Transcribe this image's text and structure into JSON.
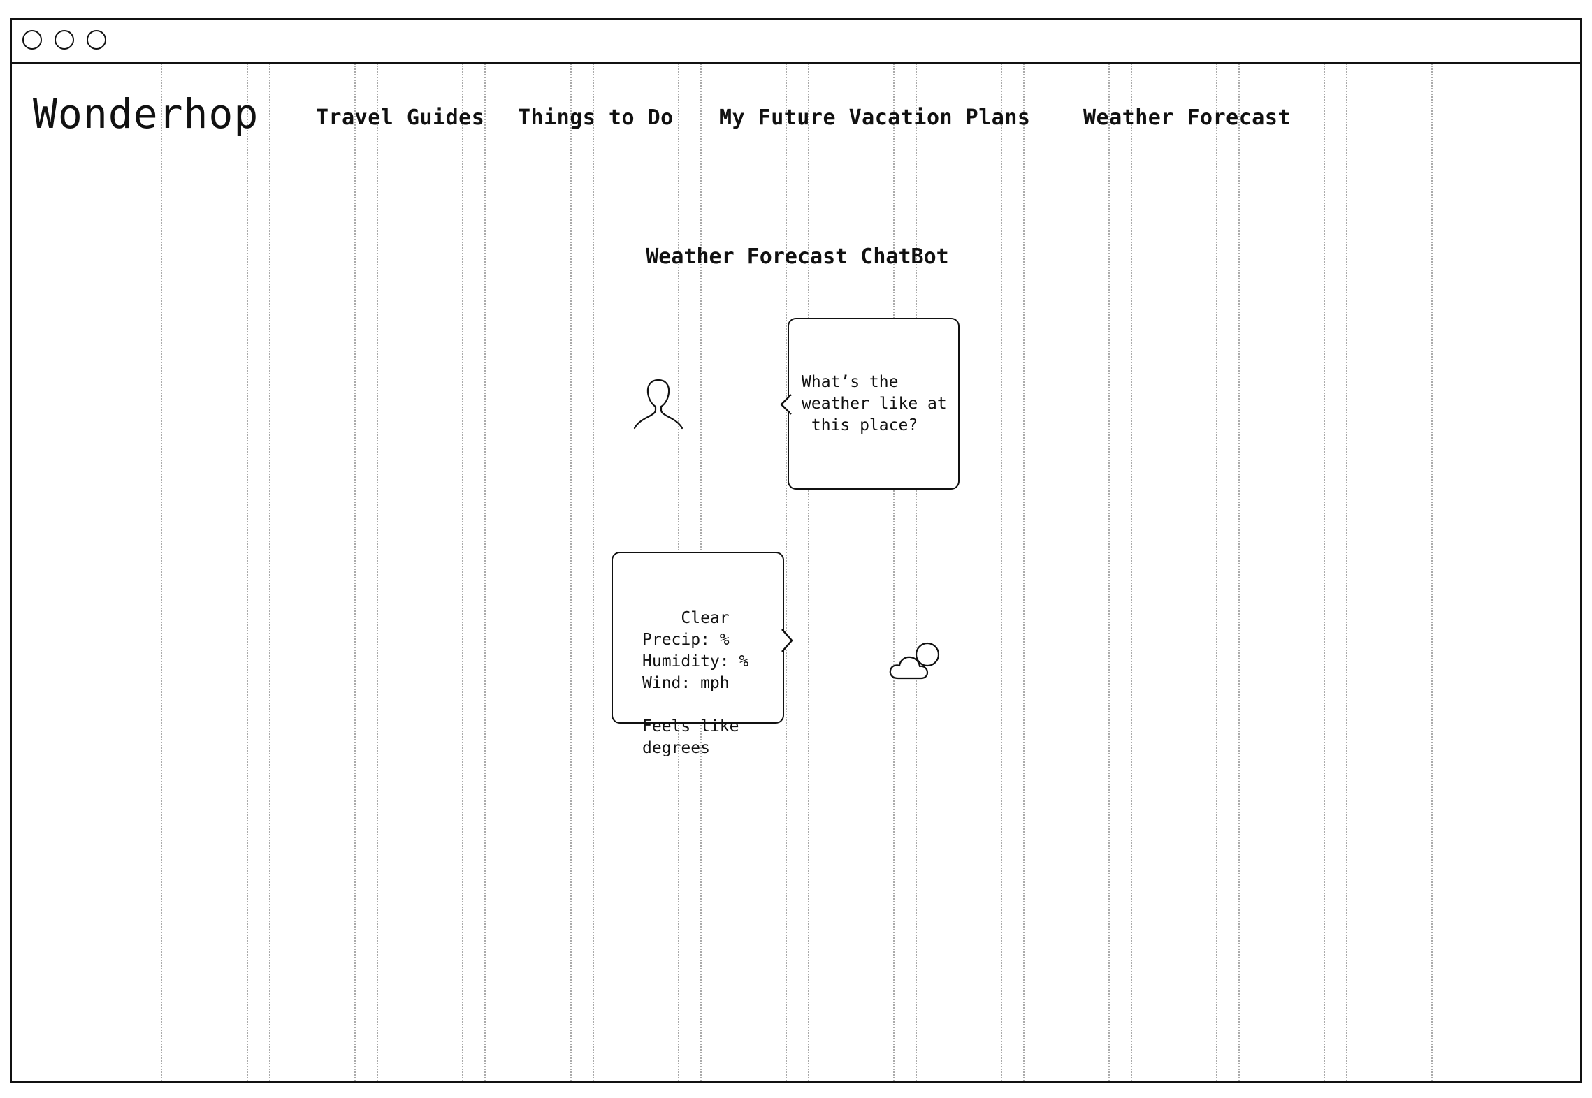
{
  "app": {
    "brand": "Wonderhop"
  },
  "window_controls": [
    "close",
    "minimize",
    "maximize"
  ],
  "nav": {
    "items": [
      {
        "label": "Travel Guides"
      },
      {
        "label": "Things to Do"
      },
      {
        "label": "My Future Vacation Plans"
      },
      {
        "label": "Weather Forecast"
      }
    ]
  },
  "chatbot": {
    "title": "Weather Forecast ChatBot",
    "user_message": "What’s the\nweather like at\n this place?",
    "bot_message": "Clear\nPrecip: %\nHumidity: %\nWind: mph\n\nFeels like\ndegrees",
    "user_icon": "user-avatar-icon",
    "bot_icon": "partly-cloudy-icon"
  }
}
